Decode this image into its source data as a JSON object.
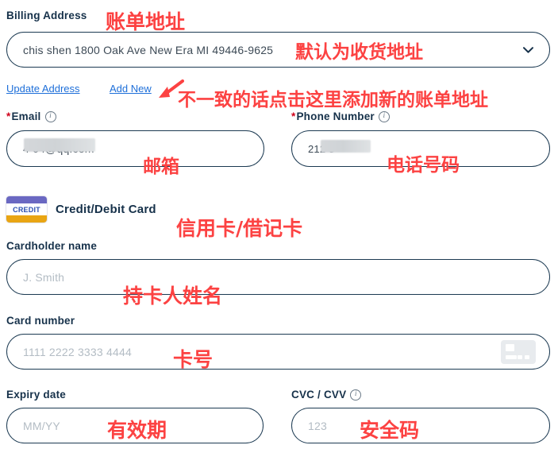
{
  "billing": {
    "label": "Billing Address",
    "selected_address": "chis shen 1800 Oak Ave New Era MI 49446-9625",
    "chevron_icon": "chevron-down-icon",
    "update_link": "Update Address",
    "add_new_link": "Add New"
  },
  "email": {
    "required_marker": "*",
    "label": "Email",
    "info_icon": "info-icon",
    "value": "4        04@qq.com"
  },
  "phone": {
    "required_marker": "*",
    "label": "Phone Number",
    "info_icon": "info-icon",
    "value": "212          8"
  },
  "card_section": {
    "badge_text": "CREDIT",
    "badge_icon": "credit-card-badge-icon",
    "title": "Credit/Debit Card"
  },
  "cardholder": {
    "label": "Cardholder name",
    "placeholder": "J. Smith",
    "value": ""
  },
  "card_number": {
    "label": "Card number",
    "placeholder": "1111 2222 3333 4444",
    "value": "",
    "card_icon": "card-brand-placeholder-icon"
  },
  "expiry": {
    "label": "Expiry date",
    "placeholder": "MM/YY",
    "value": ""
  },
  "cvc": {
    "label": "CVC / CVV",
    "info_icon": "info-icon",
    "placeholder": "123",
    "value": ""
  },
  "annotations": {
    "billing_address": "账单地址",
    "default_shipping": "默认为收货地址",
    "add_new_hint": "不一致的话点击这里添加新的账单地址",
    "email": "邮箱",
    "phone": "电话号码",
    "credit_debit": "信用卡/借记卡",
    "cardholder": "持卡人姓名",
    "card_number": "卡号",
    "expiry": "有效期",
    "cvc": "安全码",
    "arrow_icon": "red-arrow-icon"
  },
  "colors": {
    "annotation_red": "#fc4242",
    "label_navy": "#16314a",
    "link_blue": "#1e6fd9",
    "border_navy": "#1c3a52",
    "placeholder_gray": "#b3bcc4",
    "badge_purple": "#6a68c2",
    "badge_orange": "#e9a513"
  }
}
